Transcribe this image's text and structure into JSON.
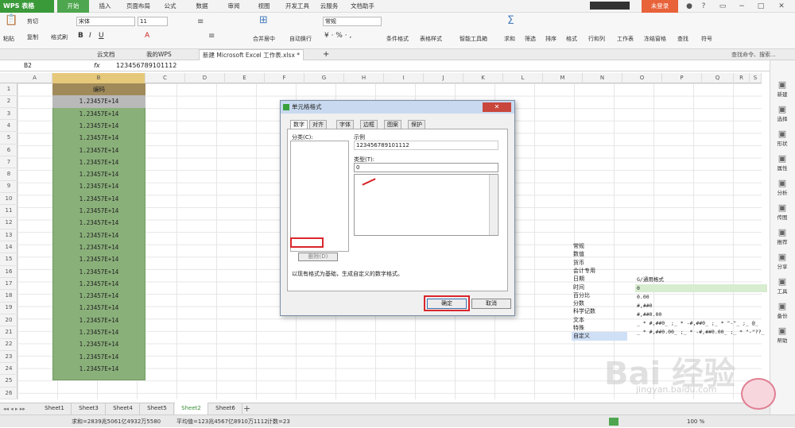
{
  "app": {
    "menu_label": "WPS 表格",
    "login_label": "未登录"
  },
  "ribbon_tabs": [
    "开始",
    "插入",
    "页面布局",
    "公式",
    "数据",
    "审阅",
    "视图",
    "开发工具",
    "云服务",
    "文档助手"
  ],
  "ribbon": {
    "paste": "粘贴",
    "cut": "剪切",
    "copy": "复制",
    "format_painter": "格式刷",
    "font_name": "宋体",
    "font_size": "11",
    "merge_center": "合并居中",
    "wrap_text": "自动换行",
    "number_format": "常规",
    "conditional_format": "条件格式",
    "table_style": "表格样式",
    "smart_toolbox": "智能工具箱",
    "sum": "求和",
    "filter": "筛选",
    "sort": "排序",
    "format": "格式",
    "row_col": "行和列",
    "worksheet": "工作表",
    "freeze": "冻结窗格",
    "find": "查找",
    "symbol": "符号"
  },
  "doc_tabs": [
    {
      "label": "云文档"
    },
    {
      "label": "我的WPS"
    },
    {
      "label": "新建 Microsoft Excel 工作表.xlsx *"
    }
  ],
  "search_hint": "查找命令、搜索...",
  "formula_bar": {
    "name_box": "B2",
    "fx": "fx",
    "value": "123456789101112"
  },
  "columns": [
    "A",
    "B",
    "C",
    "D",
    "E",
    "F",
    "G",
    "H",
    "I",
    "J",
    "K",
    "L",
    "M",
    "N",
    "O",
    "P",
    "Q",
    "R",
    "S"
  ],
  "rows": [
    "1",
    "2",
    "3",
    "4",
    "5",
    "6",
    "7",
    "8",
    "9",
    "10",
    "11",
    "12",
    "13",
    "14",
    "15",
    "16",
    "17",
    "18",
    "19",
    "20",
    "21",
    "22",
    "23",
    "24",
    "25",
    "26"
  ],
  "column_b": {
    "header": "编码",
    "values": [
      "1.23457E+14",
      "1.23457E+14",
      "1.23457E+14",
      "1.23457E+14",
      "1.23457E+14",
      "1.23457E+14",
      "1.23457E+14",
      "1.23457E+14",
      "1.23457E+14",
      "1.23457E+14",
      "1.23457E+14",
      "1.23457E+14",
      "1.23457E+14",
      "1.23457E+14",
      "1.23457E+14",
      "1.23457E+14",
      "1.23457E+14",
      "1.23457E+14",
      "1.23457E+14",
      "1.23457E+14",
      "1.23457E+14",
      "1.23457E+14",
      "1.23457E+14"
    ]
  },
  "dialog": {
    "title": "单元格格式",
    "tabs": [
      "数字",
      "对齐",
      "字体",
      "边框",
      "图案",
      "保护"
    ],
    "category_label": "分类(C):",
    "categories": [
      "常规",
      "数值",
      "货币",
      "会计专用",
      "日期",
      "时间",
      "百分比",
      "分数",
      "科学记数",
      "文本",
      "特殊",
      "自定义"
    ],
    "sample_label": "示例",
    "sample_value": "123456789101112",
    "type_label": "类型(T):",
    "type_value": "0",
    "formats": [
      "G/通用格式",
      "0",
      "0.00",
      "#,##0",
      "#,##0.00",
      "_ * #,##0_ ;_ * -#,##0_ ;_ * \"-\"_ ;_ @_",
      "_ * #,##0.00_ ;_ * -#,##0.00_ ;_ * \"-\"??_"
    ],
    "delete_label": "删除(D)",
    "hint": "以现有格式为基础，生成自定义的数字格式。",
    "ok_label": "确定",
    "cancel_label": "取消"
  },
  "sheets": [
    "Sheet1",
    "Sheet3",
    "Sheet4",
    "Sheet5",
    "Sheet2",
    "Sheet6"
  ],
  "active_sheet": "Sheet2",
  "status": {
    "sum": "求和=2839兆5061亿4932万5580",
    "average": "平均值=123兆4567亿8910万1112",
    "count": "计数=23",
    "zoom": "100 %"
  },
  "right_panel": [
    "新建",
    "选择",
    "形状",
    "属性",
    "分析",
    "传图",
    "推荐",
    "分享",
    "工具",
    "备份",
    "帮助"
  ],
  "watermark": {
    "logo": "Bai 经验",
    "url": "jingyan.baidu.com"
  },
  "colors": {
    "accent_green": "#4ea64e",
    "col_b_fill": "#8ab07a",
    "highlight_red": "#d9262b"
  }
}
